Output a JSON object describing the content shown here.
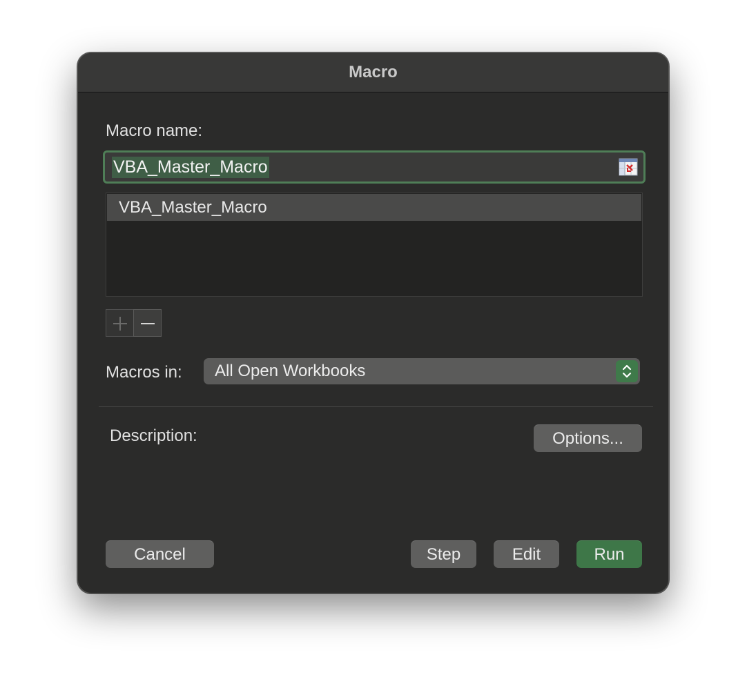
{
  "dialog": {
    "title": "Macro",
    "macro_name_label": "Macro name:",
    "macro_name_value": "VBA_Master_Macro",
    "macros_list": [
      "VBA_Master_Macro"
    ],
    "macros_in_label": "Macros in:",
    "macros_in_value": "All Open Workbooks",
    "description_label": "Description:",
    "options_label": "Options...",
    "buttons": {
      "cancel": "Cancel",
      "step": "Step",
      "edit": "Edit",
      "run": "Run"
    },
    "icons": {
      "ref": "range-reference-icon",
      "add": "plus-icon",
      "remove": "minus-icon",
      "stepper": "up-down-chevron-icon"
    },
    "colors": {
      "accent": "#3e7748",
      "focus_ring": "#4f7e57",
      "window_bg": "#2b2b2a"
    }
  }
}
